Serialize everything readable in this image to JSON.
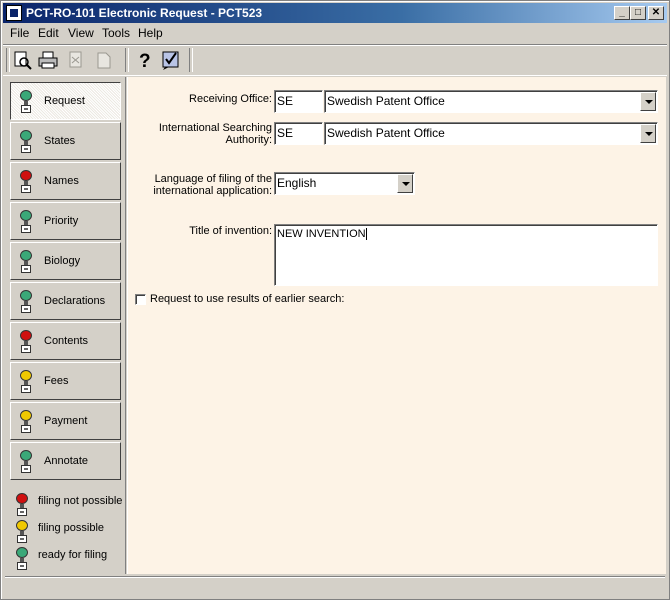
{
  "window": {
    "title": "PCT-RO-101 Electronic Request - PCT523"
  },
  "menu": [
    {
      "label": "File"
    },
    {
      "label": "Edit"
    },
    {
      "label": "View"
    },
    {
      "label": "Tools"
    },
    {
      "label": "Help"
    }
  ],
  "toolbar": {
    "icons": [
      "preview-icon",
      "print-icon",
      "disabled-doc-icon",
      "disabled-page-icon",
      "help-icon",
      "validate-icon"
    ]
  },
  "nav": {
    "items": [
      {
        "label": "Request",
        "status": "ready"
      },
      {
        "label": "States",
        "status": "ready"
      },
      {
        "label": "Names",
        "status": "not-possible"
      },
      {
        "label": "Priority",
        "status": "ready"
      },
      {
        "label": "Biology",
        "status": "ready"
      },
      {
        "label": "Declarations",
        "status": "ready"
      },
      {
        "label": "Contents",
        "status": "not-possible"
      },
      {
        "label": "Fees",
        "status": "possible"
      },
      {
        "label": "Payment",
        "status": "possible"
      },
      {
        "label": "Annotate",
        "status": "ready"
      }
    ],
    "legend": [
      {
        "label": "filing not possible",
        "status": "not-possible"
      },
      {
        "label": "filing possible",
        "status": "possible"
      },
      {
        "label": "ready for filing",
        "status": "ready"
      }
    ]
  },
  "colors": {
    "not-possible": "#d01010",
    "possible": "#f0c800",
    "ready": "#3aa878",
    "panel_bg": "#fdf3e6"
  },
  "form": {
    "receiving_office": {
      "label": "Receiving Office:",
      "code": "SE",
      "name": "Swedish Patent Office"
    },
    "isa": {
      "label_line1": "International Searching",
      "label_line2": "Authority:",
      "code": "SE",
      "name": "Swedish Patent Office"
    },
    "language": {
      "label_line1": "Language of filing of the",
      "label_line2": "international application:",
      "value": "English"
    },
    "title": {
      "label": "Title of invention:",
      "value": "NEW INVENTION"
    },
    "earlier_search": {
      "label": "Request to use results of earlier search:",
      "checked": false
    }
  }
}
